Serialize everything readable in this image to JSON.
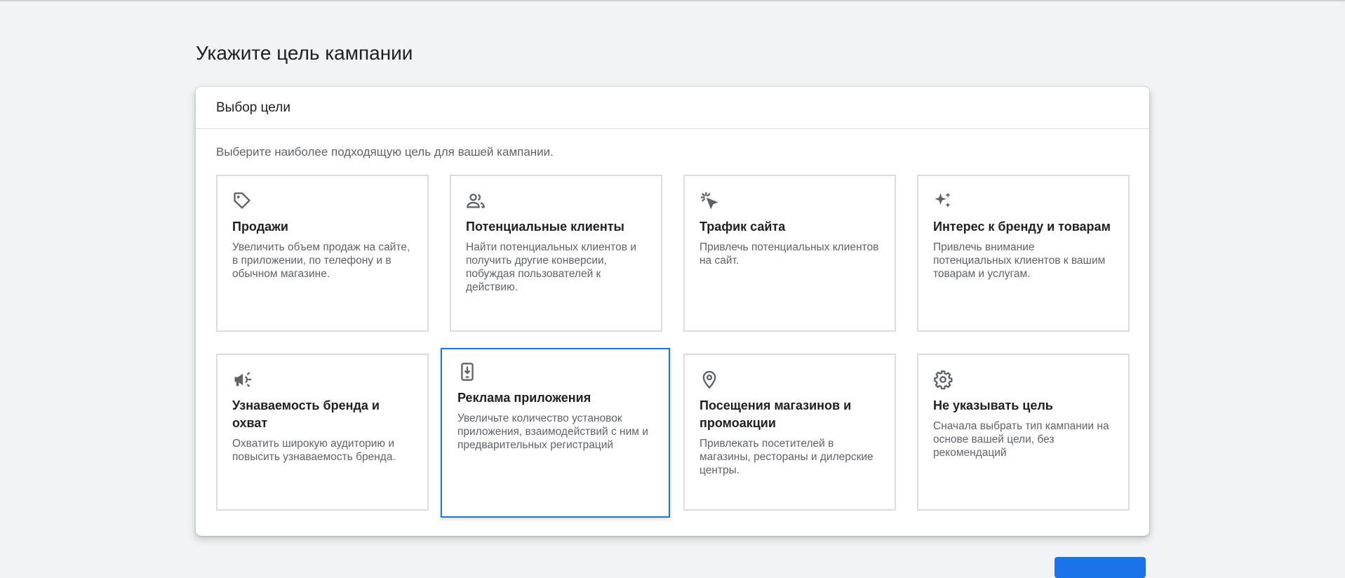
{
  "page": {
    "title": "Укажите цель кампании"
  },
  "card": {
    "header": "Выбор цели",
    "subtitle": "Выберите наиболее подходящую цель для вашей кампании."
  },
  "goals": [
    {
      "icon": "tag-icon",
      "title": "Продажи",
      "description": "Увеличить объем продаж на сайте, в приложении, по телефону и в обычном магазине.",
      "selected": false
    },
    {
      "icon": "people-icon",
      "title": "Потенциальные клиенты",
      "description": "Найти потенциальных клиентов и получить другие конверсии, побуждая пользователей к действию.",
      "selected": false
    },
    {
      "icon": "cursor-click-icon",
      "title": "Трафик сайта",
      "description": "Привлечь потенциальных клиентов на сайт.",
      "selected": false
    },
    {
      "icon": "sparkle-icon",
      "title": "Интерес к бренду и товарам",
      "description": "Привлечь внимание потенциальных клиентов к вашим товарам и услугам.",
      "selected": false
    },
    {
      "icon": "megaphone-icon",
      "title": "Узнаваемость бренда и охват",
      "description": "Охватить широкую аудиторию и повысить узнаваемость бренда.",
      "selected": false
    },
    {
      "icon": "phone-download-icon",
      "title": "Реклама приложения",
      "description": "Увеличьте количество установок приложения, взаимодействий с ним и предварительных регистраций",
      "selected": true
    },
    {
      "icon": "location-pin-icon",
      "title": "Посещения магазинов и промоакции",
      "description": "Привлекать посетителей в магазины, рестораны и дилерские центры.",
      "selected": false
    },
    {
      "icon": "gear-icon",
      "title": "Не указывать цель",
      "description": "Сначала выбрать тип кампании на основе вашей цели, без рекомендаций",
      "selected": false
    }
  ],
  "colors": {
    "accent": "#1a73e8",
    "background": "#f1f3f4",
    "border": "#dadce0",
    "text_primary": "#202124",
    "text_secondary": "#5f6368"
  }
}
